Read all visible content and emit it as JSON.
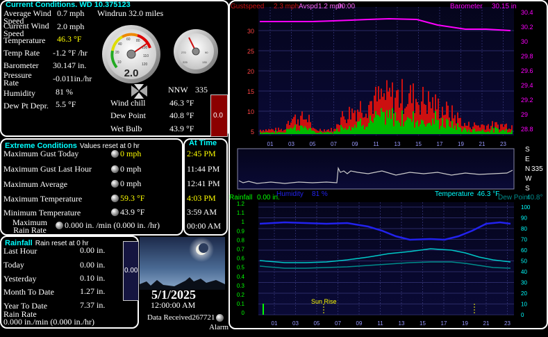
{
  "current": {
    "title": "Current Conditions. WD 10.375123",
    "rows": [
      {
        "label": "Average Wind Speed",
        "value": "0.7 mph",
        "extra": "Windrun 32.0 miles"
      },
      {
        "label": "Current Wind Speed",
        "value": "2.0 mph"
      },
      {
        "label": "Temperature",
        "value": "46.3 °F"
      },
      {
        "label": "Temp Rate",
        "value": "-1.2 °F /hr"
      },
      {
        "label": "Barometer",
        "value": "30.147 in."
      },
      {
        "label": "Pressure Rate",
        "value": "-0.011in./hr"
      },
      {
        "label": "Humidity",
        "value": "81 %"
      },
      {
        "label": "Dew Pt Depr.",
        "value": "5.5 °F"
      }
    ],
    "gauge_value": "2.0",
    "wind_dir": "NNW",
    "wind_deg": "335",
    "derived": [
      {
        "label": "Wind chill",
        "value": "46.3 °F"
      },
      {
        "label": "Dew Point",
        "value": "40.8 °F"
      },
      {
        "label": "Wet Bulb",
        "value": "43.9 °F"
      }
    ],
    "bar_value": "0.0"
  },
  "extremes": {
    "title": "Extreme Conditions",
    "subtitle": "Values reset at 0 hr",
    "time_title": "At Time",
    "rows": [
      {
        "label": "Maximum Gust Today",
        "value": "0 mph",
        "time": "2:45 PM"
      },
      {
        "label": "Maximum Gust Last Hour",
        "value": "0 mph",
        "time": "11:44 PM"
      },
      {
        "label": "Maximum Average",
        "value": "0 mph",
        "time": "12:41 PM"
      },
      {
        "label": "Maximum Temperature",
        "value": "59.3 °F",
        "time": "4:03 PM"
      },
      {
        "label": "Minimum Temperature",
        "value": "43.9 °F",
        "time": "3:59 AM"
      },
      {
        "label": "Maximum Rain Rate",
        "value": "0.000 in. /min (0.000 in. /hr)",
        "time": "00:00 AM"
      }
    ]
  },
  "rainfall": {
    "title": "Rainfall",
    "subtitle": "Rain reset at 0 hr",
    "rows": [
      {
        "label": "Last Hour",
        "value": "0.00 in."
      },
      {
        "label": "Today",
        "value": "0.00 in."
      },
      {
        "label": "Yesterday",
        "value": "0.10 in."
      },
      {
        "label": "Month To Date",
        "value": "1.27 in."
      },
      {
        "label": "Year To Date",
        "value": "7.37 in."
      }
    ],
    "rate_label": "Rain Rate",
    "rate_value": "0.000 in./min (0.000 in./hr)",
    "bar_value": "0.00"
  },
  "moon": {
    "date": "5/1/2025",
    "time": "12:00:00 AM",
    "data_received": "Data Received267721",
    "alarm": "Alarm"
  },
  "graph_top": {
    "legend_gust": "Gustspeed",
    "legend_gust_val": "2.3 mph",
    "legend_avg": "Avspd",
    "legend_avg_val": "1.2 mph",
    "legend_time": "00:00",
    "legend_baro": "Barometer",
    "legend_baro_val": "30.15 in",
    "left_ticks": [
      "30",
      "25",
      "20",
      "15",
      "10",
      "5"
    ],
    "right_ticks": [
      "30.4",
      "30.2",
      "30",
      "29.8",
      "29.6",
      "29.4",
      "29.2",
      "29",
      "28.8"
    ],
    "x_ticks": [
      "01",
      "03",
      "05",
      "07",
      "09",
      "11",
      "13",
      "15",
      "17",
      "19",
      "21",
      "23"
    ]
  },
  "graph_dir": {
    "compass": [
      "S",
      "E",
      "N",
      "W",
      "S"
    ],
    "value": "335"
  },
  "graph_bottom": {
    "legend_humidity": "Humidity",
    "legend_humidity_val": "81 %",
    "legend_temp": "Temperature",
    "legend_temp_val": "46.3 °F",
    "legend_rain": "Rainfall",
    "legend_rain_val": "0.00 in.",
    "legend_dew": "Dew Point",
    "legend_dew_val": "40.8°",
    "left_ticks": [
      "1.2",
      "1.1",
      "1",
      "0.9",
      "0.8",
      "0.7",
      "0.6",
      "0.5",
      "0.4",
      "0.3",
      "0.2",
      "0.1",
      "0"
    ],
    "right_ticks": [
      "100",
      "90",
      "80",
      "70",
      "60",
      "50",
      "40",
      "30",
      "20",
      "10",
      "0"
    ],
    "x_ticks": [
      "01",
      "03",
      "05",
      "07",
      "09",
      "11",
      "13",
      "15",
      "17",
      "19",
      "21",
      "23"
    ],
    "sunrise": "Sun Rise"
  },
  "colors": {
    "cyan": "#00ffff",
    "yellow": "#ffff00",
    "barometer": "#ff00ff",
    "gust": "#cc1010",
    "average": "#00bb00",
    "humidity": "#2222ee",
    "temperature": "#00c8c8",
    "dewpoint": "#008c8c",
    "bar_fill": "#8b0000"
  }
}
